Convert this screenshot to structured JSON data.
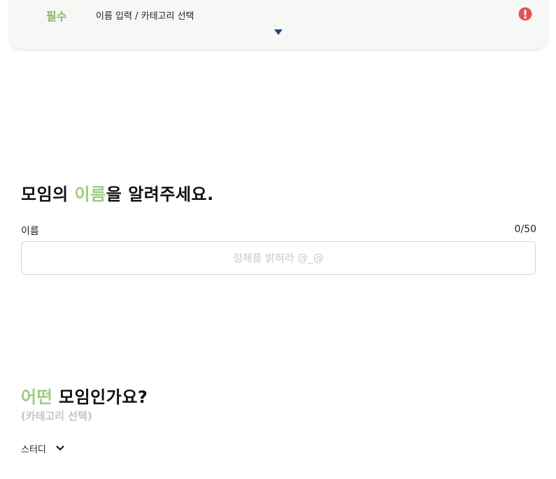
{
  "requirements": {
    "badge": "필수",
    "items": "이름 입력 / 카테고리 선택"
  },
  "name_section": {
    "heading_prefix": "모임의 ",
    "heading_accent": "이름",
    "heading_suffix": "을 알려주세요.",
    "label": "이름",
    "counter": "0/50",
    "placeholder": "정체를 밝혀라 @_@",
    "value": ""
  },
  "category_section": {
    "heading_accent": "어떤",
    "heading_rest": " 모임인가요?",
    "subtitle": "(카테고리 선택)",
    "selected": "스터디"
  },
  "colors": {
    "accent": "#9ccc7e",
    "badge": "#8fb56a",
    "warning": "#e05555",
    "arrow": "#1f4e79"
  },
  "icons": {
    "warning": "exclamation-circle-icon",
    "toggle": "caret-down-icon",
    "select": "chevron-down-icon"
  }
}
